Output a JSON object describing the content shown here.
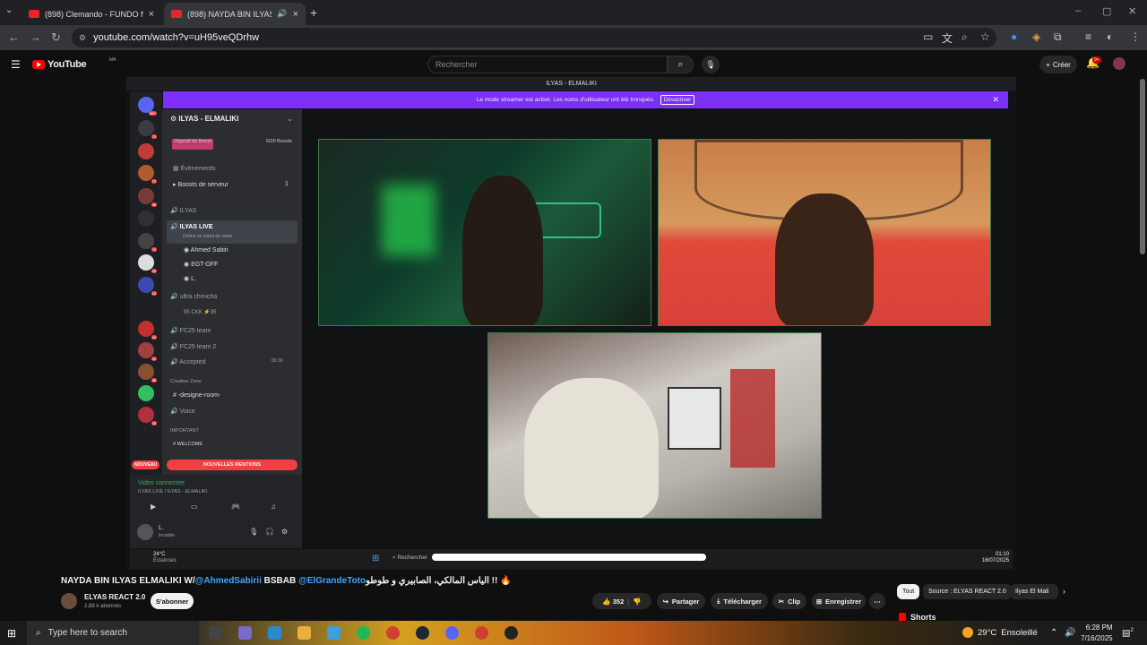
{
  "browser": {
    "tabs": [
      {
        "title": "(898) Clemando - FUNDO ft. @",
        "close": "×"
      },
      {
        "title": "(898) NAYDA BIN ILYAS ELM",
        "close": "×"
      }
    ],
    "new_tab": "+",
    "window_controls": {
      "minimize": "–",
      "maximize": "▢",
      "close": "✕"
    },
    "url": "youtube.com/watch?v=uH95veQDrhw",
    "nav": {
      "back": "←",
      "forward": "→",
      "reload": "↻"
    }
  },
  "youtube": {
    "logo": "YouTube",
    "region": "MA",
    "search_placeholder": "Rechercher",
    "create_label": "Créer",
    "notifications_badge": "9+",
    "video": {
      "title_prefix": "NAYDA BIN ILYAS ELMALIKI W/",
      "mention1": "@AhmedSabirii",
      "title_mid": " BSBAB ",
      "mention2": "@ElGrandeToto",
      "title_suffix": "‫الياس المالكي، الصابيري و طوطو‬ !! 🔥",
      "channel_name": "ELYAS REACT 2.0",
      "subscribers": "2,88 k abonnés",
      "subscribe_label": "S'abonner",
      "likes": "352",
      "share_label": "Partager",
      "download_label": "Télécharger",
      "clip_label": "Clip",
      "save_label": "Enregistrer",
      "more_label": "⋯"
    },
    "chips": [
      "Tout",
      "Source : ELYAS REACT 2.0",
      "Ilyas El Mali"
    ],
    "shorts_label": "Shorts"
  },
  "discord": {
    "window_title": "ILYAS - ELMALIKI",
    "streamer_banner": "Le mode streamer est activé. Les noms d'utilisateur ont été tronqués.",
    "disable_label": "Désactiver",
    "server_name": "ILYAS - ELMALIKI",
    "boost_goal": "Objectif de Boost",
    "boost_count": "6/20 Boosts",
    "events": "Évènements",
    "server_boosts": "Boosts de serveur",
    "server_boosts_count": "1",
    "channels": [
      "ILYAS",
      "ILYAS LIVE"
    ],
    "status_hint": "Définir un statut de salon",
    "voice_members": [
      "Ahmed Sabiri",
      "EGT-OFF",
      "L."
    ],
    "channels_more": [
      "ultra chmicha",
      "FC25 team",
      "FC25 team 2",
      "Accepted"
    ],
    "stream_member": "95 CKK",
    "stream_count": "95",
    "accepted_counts": [
      "00",
      "30"
    ],
    "creative_zone": "Creative Zone",
    "designe_room": "-designe-room-",
    "voice_room": "Voice",
    "important": "IMPORTANT",
    "welcome": "WELCOME",
    "new_badge": "NOUVEAU",
    "new_mentions": "NOUVELLES MENTIONS",
    "video_connected": "Vidéo connectée",
    "voice_path": "ILYAS LIVE / ILYAS - ELMALIKI",
    "user_name": "L.",
    "user_status": "Invisible",
    "server_badges": [
      "99+",
      "73",
      "77",
      "46",
      "72",
      "40",
      "16",
      "71",
      "43",
      "41",
      "56",
      "15"
    ],
    "inner_taskbar": {
      "weather": "24°C",
      "weather_desc": "Éclaircies",
      "search": "Rechercher",
      "time": "01:10",
      "date": "16/07/2025"
    }
  },
  "windows": {
    "search_placeholder": "Type here to search",
    "weather_temp": "29°C",
    "weather_desc": "Ensoleillé",
    "time": "6:28 PM",
    "date": "7/16/2025",
    "notif_count": "2"
  }
}
